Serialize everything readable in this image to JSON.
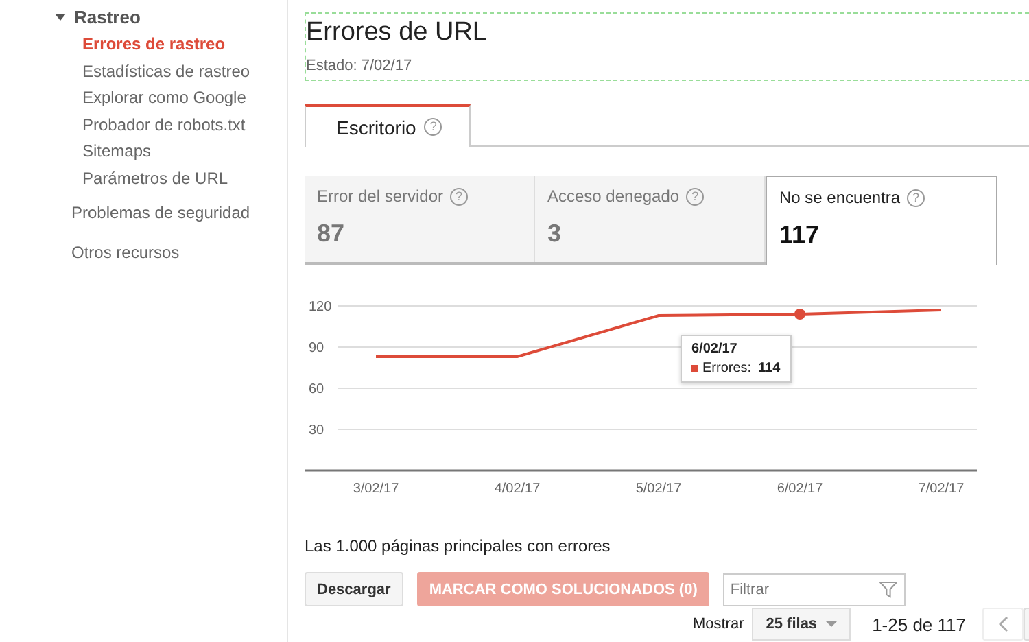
{
  "sidebar": {
    "section": {
      "label": "Rastreo",
      "expanded": true,
      "children": [
        {
          "label": "Errores de rastreo",
          "selected": true
        },
        {
          "label": "Estadísticas de rastreo",
          "selected": false
        },
        {
          "label": "Explorar como Google",
          "selected": false
        },
        {
          "label": "Probador de robots.txt",
          "selected": false
        },
        {
          "label": "Sitemaps",
          "selected": false
        },
        {
          "label": "Parámetros de URL",
          "selected": false
        }
      ]
    },
    "items": [
      {
        "label": "Problemas de seguridad"
      },
      {
        "label": "Otros recursos"
      }
    ]
  },
  "header": {
    "title": "Errores de URL",
    "status": "Estado: 7/02/17"
  },
  "tabs": [
    {
      "label": "Escritorio",
      "help": "?",
      "selected": true
    }
  ],
  "cards": [
    {
      "label": "Error del servidor",
      "help": "?",
      "count": "87",
      "selected": false
    },
    {
      "label": "Acceso denegado",
      "help": "?",
      "count": "3",
      "selected": false
    },
    {
      "label": "No se encuentra",
      "help": "?",
      "count": "117",
      "selected": true
    }
  ],
  "chart": {
    "chart_data": {
      "type": "line",
      "categories": [
        "3/02/17",
        "4/02/17",
        "5/02/17",
        "6/02/17",
        "7/02/17"
      ],
      "series": [
        {
          "name": "Errores",
          "color": "#dd4b39",
          "values": [
            83,
            83,
            113,
            114,
            117
          ]
        }
      ],
      "ylim": [
        0,
        120
      ],
      "yticks": [
        30,
        60,
        90,
        120
      ],
      "grid": true
    },
    "tooltip": {
      "title": "6/02/17",
      "separator": ":",
      "value": "114"
    }
  },
  "table": {
    "heading": "Las 1.000 páginas principales con errores",
    "download": "Descargar",
    "mark_fixed": {
      "label": "MARCAR COMO SOLUCIONADOS (0)",
      "disabled": true
    },
    "filter": {
      "placeholder": "Filtrar"
    },
    "show_label": "Mostrar",
    "rows_select": "25 filas",
    "range": "1-25 de 117"
  }
}
